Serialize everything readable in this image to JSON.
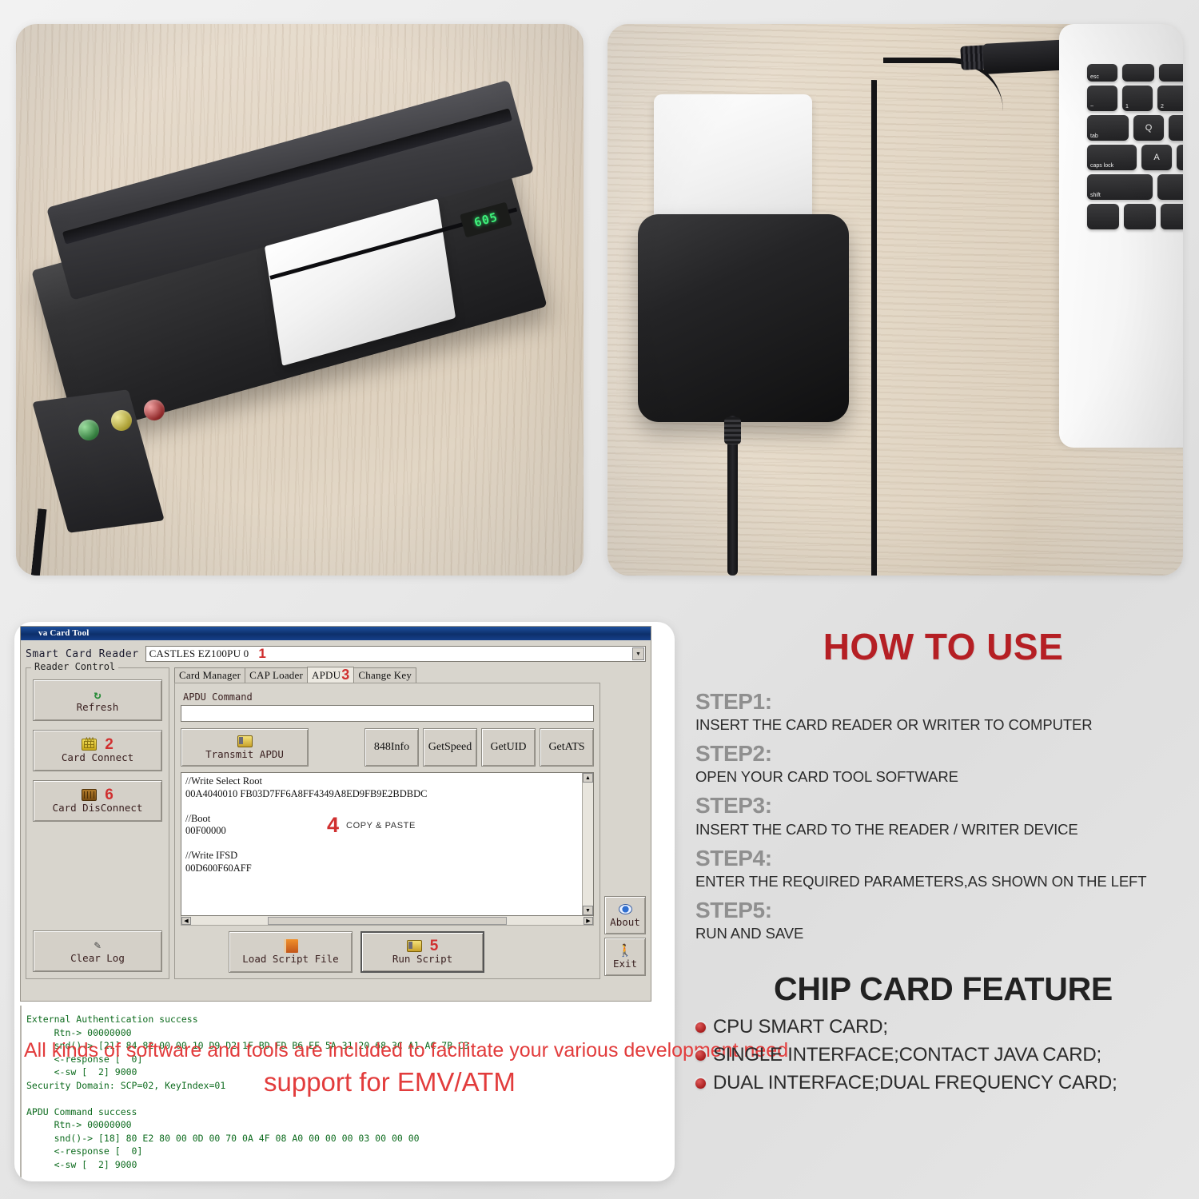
{
  "photos": {
    "left": {
      "device_label": "msr-card-reader-writer",
      "display_text": "605",
      "leds": [
        "green",
        "yellow",
        "red"
      ]
    },
    "right": {
      "device_label": "usb-smart-card-reader",
      "keyboard_keys": [
        "esc",
        "~",
        "!",
        "1",
        "2",
        "tab",
        "Q",
        "caps lock",
        "A",
        "shift"
      ]
    }
  },
  "software": {
    "window_title": "va Card Tool",
    "reader_label": "Smart Card Reader",
    "reader_value": "CASTLES EZ100PU 0",
    "reader_marker": "1",
    "reader_control": {
      "legend": "Reader Control",
      "buttons": [
        {
          "label": "Refresh",
          "marker": "",
          "icon": "refresh-icon"
        },
        {
          "label": "Card Connect",
          "marker": "2",
          "icon": "chip-card-icon"
        },
        {
          "label": "Card DisConnect",
          "marker": "6",
          "icon": "chip-card-disconnect-icon"
        },
        {
          "label": "Clear Log",
          "marker": "",
          "icon": "broom-icon"
        }
      ]
    },
    "tabs": [
      {
        "label": "Card Manager",
        "marker": "",
        "active": false
      },
      {
        "label": "CAP Loader",
        "marker": "",
        "active": false
      },
      {
        "label": "APDU",
        "marker": "3",
        "active": true
      },
      {
        "label": "Change Key",
        "marker": "",
        "active": false
      }
    ],
    "apdu": {
      "legend": "APDU Command",
      "input_value": "",
      "transmit_label": "Transmit APDU",
      "quick_buttons": [
        "848Info",
        "GetSpeed",
        "GetUID",
        "GetATS"
      ],
      "script_text": "//Write Select Root\n00A4040010 FB03D7FF6A8FF4349A8ED9FB9E2BDBDC\n\n//Boot\n00F00000\n\n//Write IFSD\n00D600F60AFF",
      "copy_marker": "4",
      "copy_hint": "COPY & PASTE"
    },
    "bottom_buttons": [
      {
        "label": "Load Script File",
        "marker": "",
        "icon": "book-icon"
      },
      {
        "label": "Run Script",
        "marker": "5",
        "icon": "run-icon"
      }
    ],
    "side_buttons": [
      {
        "label": "About",
        "marker": "",
        "icon": "eye-icon"
      },
      {
        "label": "Exit",
        "marker": "",
        "icon": "running-man-icon"
      }
    ],
    "console_log": "External Authentication success\n     Rtn-> 00000000\n     snd()-> [21] 84 82 00 00 10 D9 D2 1F BD FD B6 EF 5A 31 20 68 3C A1 AC 7B C3\n     <-response [  0]\n     <-sw [  2] 9000\nSecurity Domain: SCP=02, KeyIndex=01\n\nAPDU Command success\n     Rtn-> 00000000\n     snd()-> [18] 80 E2 80 00 0D 00 70 0A 4F 08 A0 00 00 00 03 00 00 00\n     <-response [  0]\n     <-sw [  2] 9000",
    "overlay_line1": "All kinds of software and tools are included to facilitate your various development need",
    "overlay_line2": "support for EMV/ATM"
  },
  "howto": {
    "title": "HOW TO USE",
    "steps": [
      {
        "heading": "STEP1:",
        "text": "INSERT THE CARD READER OR WRITER TO COMPUTER"
      },
      {
        "heading": "STEP2:",
        "text": "OPEN YOUR CARD TOOL SOFTWARE"
      },
      {
        "heading": "STEP3:",
        "text": "INSERT THE CARD TO THE READER / WRITER DEVICE"
      },
      {
        "heading": "STEP4:",
        "text": " ENTER THE REQUIRED PARAMETERS,AS SHOWN ON THE LEFT"
      },
      {
        "heading": "STEP5:",
        "text": "RUN AND SAVE"
      }
    ]
  },
  "features": {
    "title": "CHIP CARD FEATURE",
    "items": [
      "CPU SMART CARD;",
      "SINGLE INTERFACE;CONTACT JAVA CARD;",
      "DUAL INTERFACE;DUAL FREQUENCY CARD;"
    ]
  },
  "colors": {
    "accent_red": "#b51f24",
    "marker_red": "#d03030",
    "step_gray": "#8f8f8f",
    "console_green": "#0d6b1e",
    "titlebar_blue": "#0d2f6b"
  }
}
